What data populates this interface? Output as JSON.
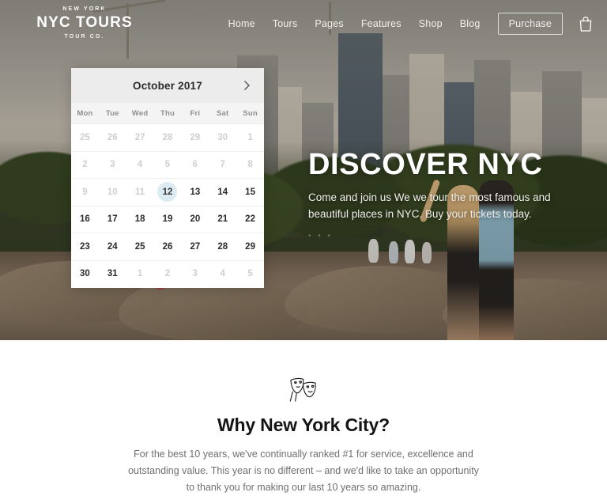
{
  "brand": {
    "eyebrow": "NEW YORK",
    "name": "NYC TOURS",
    "tagline": "TOUR CO."
  },
  "nav": {
    "items": [
      {
        "label": "Home"
      },
      {
        "label": "Tours"
      },
      {
        "label": "Pages"
      },
      {
        "label": "Features"
      },
      {
        "label": "Shop"
      },
      {
        "label": "Blog"
      }
    ],
    "purchase_label": "Purchase",
    "cart_icon": "shopping-bag-icon"
  },
  "calendar": {
    "title": "October 2017",
    "next_icon": "chevron-right-icon",
    "weekdays": [
      "Mon",
      "Tue",
      "Wed",
      "Thu",
      "Fri",
      "Sat",
      "Sun"
    ],
    "selected_day": "12",
    "highlight_color": "#dceaf2",
    "days": [
      {
        "n": "25",
        "state": "muted"
      },
      {
        "n": "26",
        "state": "muted"
      },
      {
        "n": "27",
        "state": "muted"
      },
      {
        "n": "28",
        "state": "muted"
      },
      {
        "n": "29",
        "state": "muted"
      },
      {
        "n": "30",
        "state": "muted"
      },
      {
        "n": "1",
        "state": "muted"
      },
      {
        "n": "2",
        "state": "muted"
      },
      {
        "n": "3",
        "state": "muted"
      },
      {
        "n": "4",
        "state": "muted"
      },
      {
        "n": "5",
        "state": "muted"
      },
      {
        "n": "6",
        "state": "muted"
      },
      {
        "n": "7",
        "state": "muted"
      },
      {
        "n": "8",
        "state": "muted"
      },
      {
        "n": "9",
        "state": "muted"
      },
      {
        "n": "10",
        "state": "muted"
      },
      {
        "n": "11",
        "state": "muted"
      },
      {
        "n": "12",
        "state": "selected"
      },
      {
        "n": "13",
        "state": "active"
      },
      {
        "n": "14",
        "state": "active"
      },
      {
        "n": "15",
        "state": "active"
      },
      {
        "n": "16",
        "state": "active"
      },
      {
        "n": "17",
        "state": "active"
      },
      {
        "n": "18",
        "state": "active"
      },
      {
        "n": "19",
        "state": "active"
      },
      {
        "n": "20",
        "state": "active"
      },
      {
        "n": "21",
        "state": "active"
      },
      {
        "n": "22",
        "state": "active"
      },
      {
        "n": "23",
        "state": "active"
      },
      {
        "n": "24",
        "state": "active"
      },
      {
        "n": "25",
        "state": "active"
      },
      {
        "n": "26",
        "state": "active"
      },
      {
        "n": "27",
        "state": "active"
      },
      {
        "n": "28",
        "state": "active"
      },
      {
        "n": "29",
        "state": "active"
      },
      {
        "n": "30",
        "state": "active"
      },
      {
        "n": "31",
        "state": "active"
      },
      {
        "n": "1",
        "state": "muted"
      },
      {
        "n": "2",
        "state": "muted"
      },
      {
        "n": "3",
        "state": "muted"
      },
      {
        "n": "4",
        "state": "muted"
      },
      {
        "n": "5",
        "state": "muted"
      }
    ]
  },
  "hero": {
    "title": "DISCOVER NYC",
    "subtitle": "Come and join us We we tour the most famous and beautiful places in NYC. Buy your tickets today.",
    "dots": "• • •"
  },
  "why": {
    "icon": "theater-masks-icon",
    "title": "Why New York City?",
    "body": "For the best 10 years, we've continually ranked #1 for service, excellence and outstanding value. This year is no different – and we'd like to take an opportunity to thank you for making our last 10 years so amazing."
  }
}
